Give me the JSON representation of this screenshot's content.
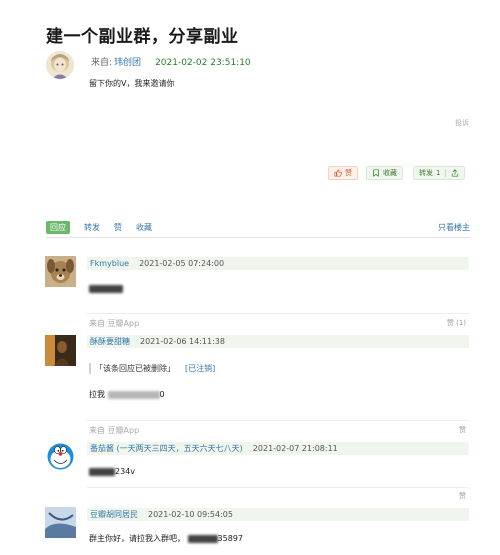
{
  "post": {
    "title": "建一个副业群，分享副业",
    "from_label": "来自:",
    "author": "玮创团",
    "time": "2021-02-02 23:51:10",
    "body": "留下你的V，我来邀请你",
    "report": "投诉"
  },
  "actions": {
    "like": "赞",
    "collect": "收藏",
    "reshare": "转发",
    "reshare_count": "1",
    "colors": {
      "like": "#d55b2e",
      "accent": "#3a7a2a"
    }
  },
  "tabs": {
    "reply": "回应",
    "reshare": "转发",
    "like": "赞",
    "collect": "收藏",
    "owner_only": "只看楼主"
  },
  "comments": [
    {
      "user": "Fkmyblue",
      "time": "2021-02-05 07:24:00",
      "text_suffix": "",
      "source": "来自  豆瓣App",
      "likes": "赞 (1)"
    },
    {
      "user": "酥酥要甜糖",
      "time": "2021-02-06 14:11:38",
      "quote": "「该条回应已被删除」",
      "quote_status": "[已注销]",
      "text_prefix": "拉我",
      "text_suffix": "0",
      "source": "来自  豆瓣App",
      "likes": "赞"
    },
    {
      "user": "番茄酱 (一天两天三四天，五天六天七八天)",
      "time": "2021-02-07 21:08:11",
      "text_suffix": "234v",
      "likes": "赞"
    },
    {
      "user": "豆瓣胡同居民",
      "time": "2021-02-10 09:54:05",
      "text_prefix": "群主你好，请拉我入群吧，",
      "text_suffix": "35897"
    }
  ]
}
